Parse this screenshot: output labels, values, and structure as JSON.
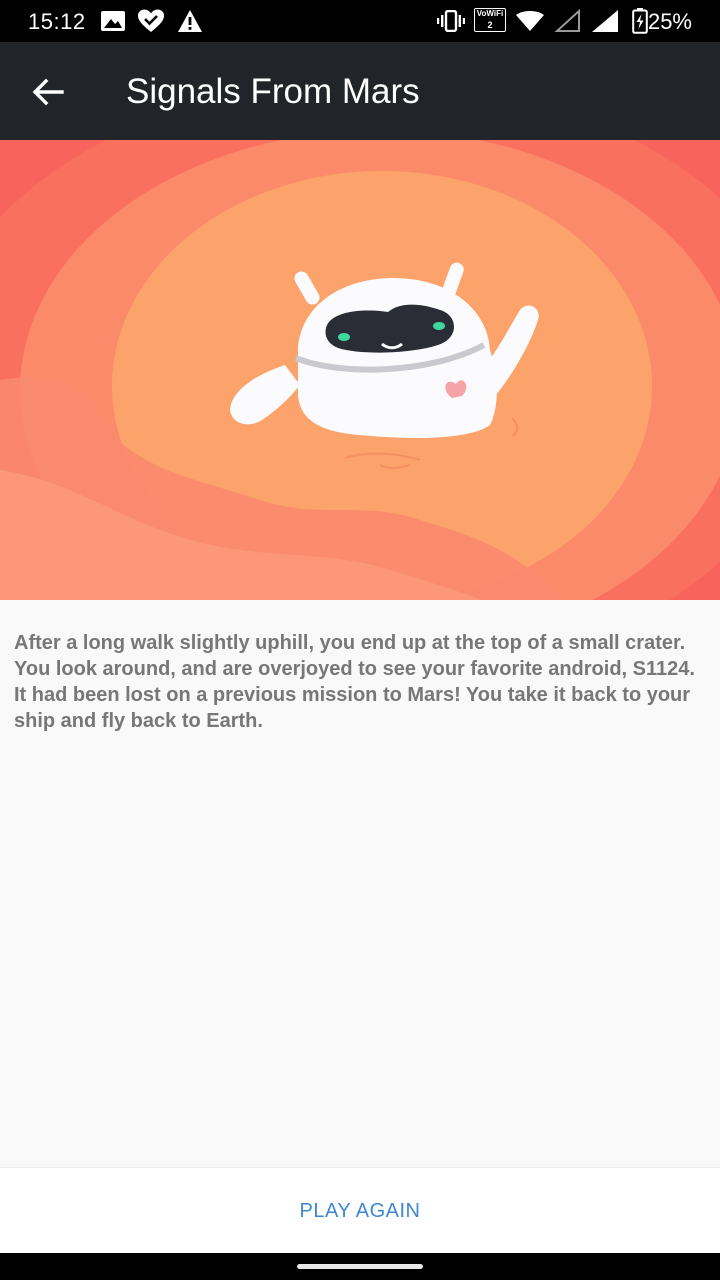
{
  "status_bar": {
    "time": "15:12",
    "battery": "25%",
    "icons": [
      "photo-icon",
      "heart-check-icon",
      "warning-icon",
      "vibrate-icon",
      "vowifi-icon",
      "wifi-icon",
      "signal-empty-icon",
      "signal-full-icon",
      "battery-charging-icon"
    ],
    "vowifi_line1": "VoWiFi",
    "vowifi_line2": "2"
  },
  "app_bar": {
    "title": "Signals From Mars",
    "back_icon": "arrow-left-icon"
  },
  "hero": {
    "illustration": "android-robot-on-mars",
    "colors": {
      "outer": "#f7645c",
      "middle": "#fb8a6b",
      "inner": "#fca36c",
      "robot": "#fbfbfd",
      "visor": "#2a2d36",
      "eyes": "#3fd7a0",
      "heart": "#f6a3a8"
    }
  },
  "story": {
    "text": "After a long walk slightly uphill, you end up at the top of a small crater. You look around, and are overjoyed to see your favorite android, S1124. It had been lost on a previous mission to Mars! You take it back to your ship and fly back to Earth."
  },
  "actions": {
    "play_again": "PLAY AGAIN",
    "accent_color": "#3f86d6"
  }
}
